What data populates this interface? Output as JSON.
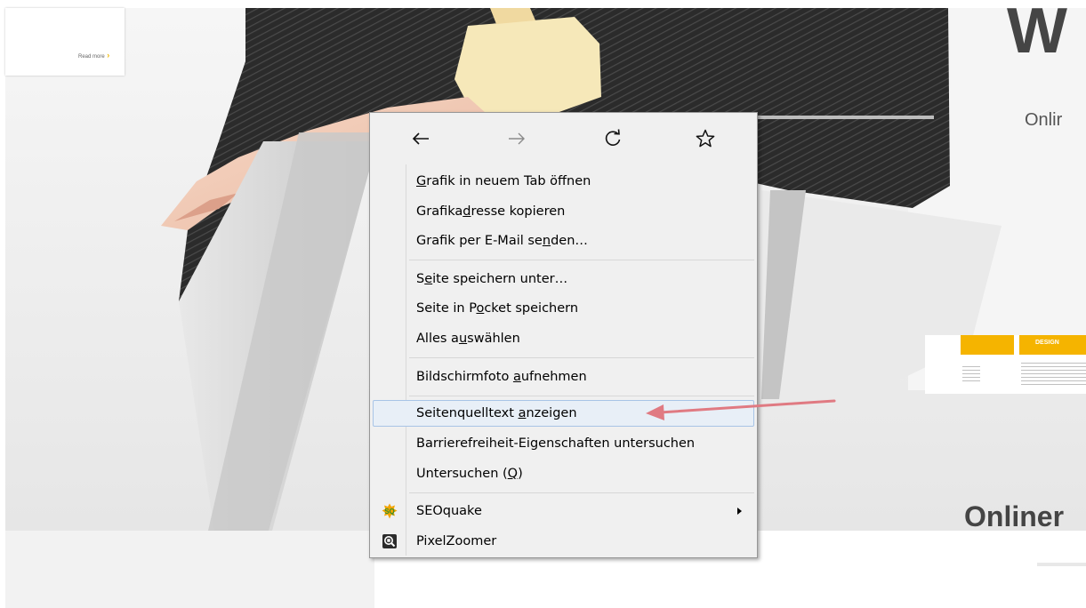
{
  "background_page": {
    "heading_fragment": "W",
    "subtitle_fragment": "Onlir",
    "section_heading_fragment": "Onliner",
    "banner_text": "",
    "banner_link": "Read more",
    "strip_tab": "DESIGN"
  },
  "context_menu": {
    "nav": {
      "back_label": "←",
      "forward_label": "→",
      "reload_label": "↻",
      "bookmark_label": "☆"
    },
    "groups": [
      [
        {
          "label": "Grafik in neuem Tab öffnen",
          "accesskey": "G"
        },
        {
          "label": "Grafikadresse kopieren",
          "accesskey": "d"
        },
        {
          "label": "Grafik per E-Mail senden…",
          "accesskey": "n"
        }
      ],
      [
        {
          "label": "Seite speichern unter…",
          "accesskey": "e"
        },
        {
          "label": "Seite in Pocket speichern",
          "accesskey": "o"
        },
        {
          "label": "Alles auswählen",
          "accesskey": "u"
        }
      ],
      [
        {
          "label": "Bildschirmfoto aufnehmen",
          "accesskey": "a"
        }
      ],
      [
        {
          "label": "Seitenquelltext anzeigen",
          "accesskey": "a",
          "highlighted": true
        },
        {
          "label": "Barrierefreiheit-Eigenschaften untersuchen"
        },
        {
          "label": "Untersuchen (Q)",
          "accesskey": "Q"
        }
      ],
      [
        {
          "label": "SEOquake",
          "icon": "seoquake-icon",
          "submenu": true
        },
        {
          "label": "PixelZoomer",
          "icon": "pixelzoomer-icon"
        }
      ]
    ]
  },
  "annotation": {
    "arrow_color": "#e07a82"
  },
  "colors": {
    "menu_bg": "#f0f0f0",
    "highlight_bg": "#e8eff7",
    "highlight_border": "#a8c4e6",
    "accent_yellow": "#f5b400"
  }
}
